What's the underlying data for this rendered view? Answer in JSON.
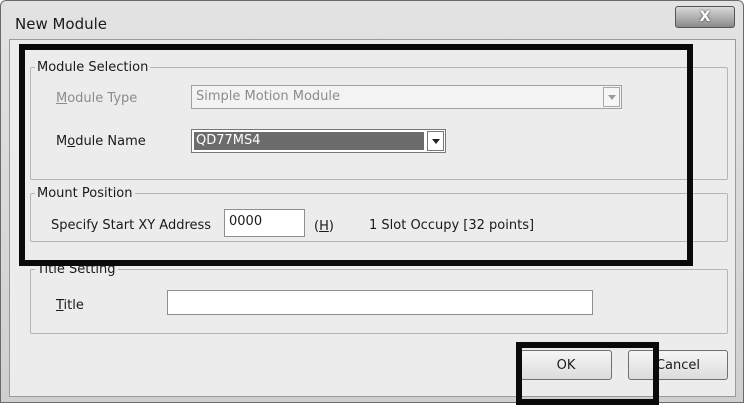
{
  "window": {
    "title": "New Module",
    "close_glyph": "X"
  },
  "module_selection": {
    "legend": "Module Selection",
    "type_label_pre": "",
    "type_label_key": "M",
    "type_label_post": "odule Type",
    "type_value": "Simple Motion Module",
    "name_label_pre": "M",
    "name_label_key": "o",
    "name_label_post": "dule Name",
    "name_value": "QD77MS4"
  },
  "mount_position": {
    "legend": "Mount Position",
    "address_label": "Specify Start XY Address",
    "address_value": "0000",
    "hex_open": "(",
    "hex_key": "H",
    "hex_close": ")",
    "slot_info": "1 Slot Occupy [32 points]"
  },
  "title_setting": {
    "legend": "Title Setting",
    "title_label_key": "T",
    "title_label_post": "itle",
    "title_value": ""
  },
  "buttons": {
    "ok": "OK",
    "cancel": "Cancel"
  },
  "colors": {
    "highlight_box": "#0a0a0a",
    "selected_combo_bg": "#6c6c6c",
    "dialog_bg": "#ececec"
  },
  "icons": {
    "close": "close-icon",
    "dropdown": "chevron-down-icon"
  }
}
